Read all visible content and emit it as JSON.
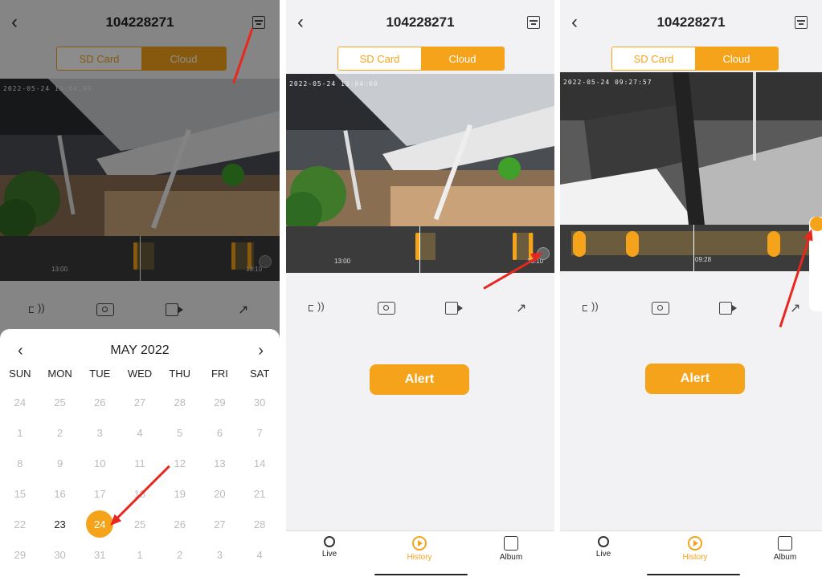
{
  "colors": {
    "accent": "#f5a31a",
    "arrow": "#e8281e",
    "timeline_bg": "#3b3b3b"
  },
  "device_title": "104228271",
  "segment": {
    "sd_card": "SD Card",
    "cloud": "Cloud"
  },
  "panels": [
    {
      "timestamp": "2022-05-24 13:04:09",
      "timeline": {
        "label_left": "13:00",
        "label_right": "13:10"
      }
    },
    {
      "timestamp": "2022-05-24 13:04:00",
      "timeline": {
        "label_left": "13:00",
        "label_right": "13:10"
      },
      "alert_label": "Alert"
    },
    {
      "timestamp": "2022-05-24 09:27:57",
      "timeline": {
        "label_center": "09:28"
      },
      "alert_label": "Alert"
    }
  ],
  "calendar": {
    "month_label": "MAY 2022",
    "weekdays": [
      "SUN",
      "MON",
      "TUE",
      "WED",
      "THU",
      "FRI",
      "SAT"
    ],
    "weeks": [
      [
        "24",
        "25",
        "26",
        "27",
        "28",
        "29",
        "30"
      ],
      [
        "1",
        "2",
        "3",
        "4",
        "5",
        "6",
        "7"
      ],
      [
        "8",
        "9",
        "10",
        "11",
        "12",
        "13",
        "14"
      ],
      [
        "15",
        "16",
        "17",
        "18",
        "19",
        "20",
        "21"
      ],
      [
        "22",
        "23",
        "24",
        "25",
        "26",
        "27",
        "28"
      ],
      [
        "29",
        "30",
        "31",
        "1",
        "2",
        "3",
        "4"
      ]
    ],
    "current_day": "23",
    "selected_day": "24"
  },
  "tabs": {
    "live": "Live",
    "history": "History",
    "album": "Album"
  },
  "icons": [
    "back-icon",
    "calendar-icon",
    "speaker-icon",
    "camera-icon",
    "record-icon",
    "fullscreen-icon",
    "zoom-icon",
    "live-icon",
    "history-icon",
    "album-icon",
    "prev-month-icon",
    "next-month-icon"
  ]
}
